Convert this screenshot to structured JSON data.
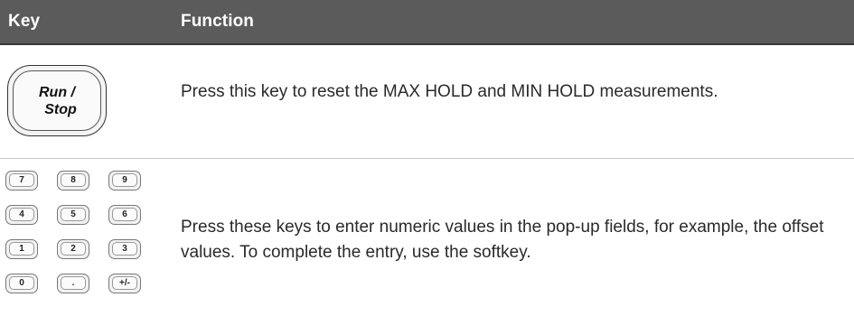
{
  "header": {
    "key": "Key",
    "function": "Function"
  },
  "rows": [
    {
      "key_label_line1": "Run /",
      "key_label_line2": "Stop",
      "description": "Press this key to reset the MAX HOLD and MIN HOLD measurements."
    },
    {
      "keypad": [
        "7",
        "8",
        "9",
        "4",
        "5",
        "6",
        "1",
        "2",
        "3",
        "0",
        ".",
        "+/-"
      ],
      "description": "Press these keys to enter numeric values in the pop-up fields, for example, the offset values. To complete the entry, use the softkey."
    }
  ]
}
